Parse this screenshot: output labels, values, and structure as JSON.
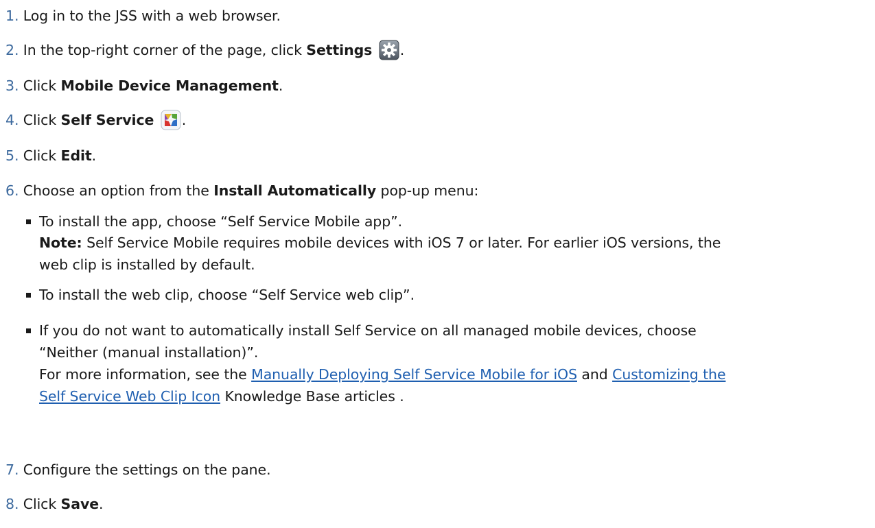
{
  "steps": [
    {
      "num": "1.",
      "text": "Log in to the JSS with a web browser."
    },
    {
      "num": "2.",
      "pre": "In the top-right corner of the page, click ",
      "bold": "Settings",
      "icon": "gear-icon",
      "post": "."
    },
    {
      "num": "3.",
      "pre": "Click ",
      "bold": "Mobile Device Management",
      "post": "."
    },
    {
      "num": "4.",
      "pre": "Click ",
      "bold": "Self Service",
      "icon": "self-service-app-icon",
      "post": "."
    },
    {
      "num": "5.",
      "pre": "Click ",
      "bold": "Edit",
      "post": "."
    },
    {
      "num": "6.",
      "pre": "Choose an option from the ",
      "bold": "Install Automatically",
      "post": " pop-up menu:"
    },
    {
      "num": "7.",
      "text": "Configure the settings on the pane."
    },
    {
      "num": "8.",
      "pre": "Click ",
      "bold": "Save",
      "post": "."
    }
  ],
  "options": {
    "app": {
      "line1": "To install the app, choose “Self Service Mobile app”.",
      "note_label": "Note:",
      "note_line1": " Self Service Mobile requires mobile devices with iOS 7 or later. For earlier iOS versions, the",
      "note_line2": "web clip is installed by default."
    },
    "webclip": {
      "line1": "To install the web clip, choose “Self Service web clip”."
    },
    "neither": {
      "line1": "If you do not want to automatically install Self Service on all managed mobile devices, choose",
      "line2": "“Neither (manual installation)”.",
      "info_pre": "For more information, see the ",
      "link1": "Manually Deploying Self Service Mobile for iOS",
      "info_mid": " and ",
      "link2_part1": "Customizing the",
      "link2_part2": "Self Service Web Clip Icon",
      "info_post": " Knowledge Base articles ."
    }
  },
  "colors": {
    "step_number": "#3d6a9e",
    "link": "#1f5fb0",
    "text": "#1a1a1a"
  }
}
